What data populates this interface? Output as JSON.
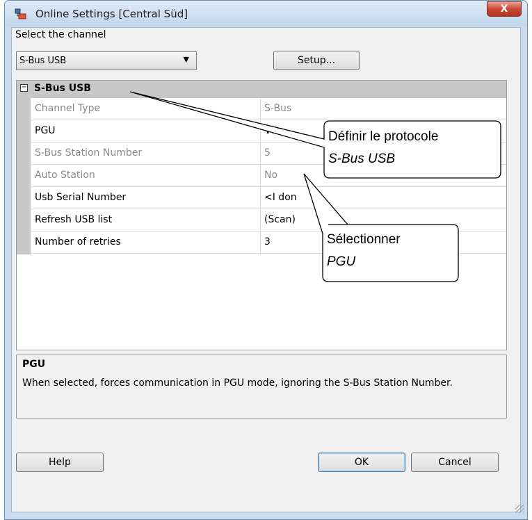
{
  "window": {
    "title": "Online Settings [Central Süd]",
    "close_label": "X"
  },
  "channel": {
    "label": "Select the channel",
    "selected": "S-Bus USB",
    "setup_label": "Setup..."
  },
  "grid": {
    "category": "S-Bus USB",
    "rows": [
      {
        "name": "Channel Type",
        "value": "S-Bus",
        "enabled": false
      },
      {
        "name": "PGU",
        "value": "Yes",
        "enabled": true
      },
      {
        "name": "S-Bus Station Number",
        "value": "5",
        "enabled": false
      },
      {
        "name": "Auto Station",
        "value": "No",
        "enabled": false
      },
      {
        "name": "Usb Serial Number",
        "value": "<I don",
        "enabled": true
      },
      {
        "name": "Refresh USB list",
        "value": "(Scan)",
        "enabled": true
      },
      {
        "name": "Number of retries",
        "value": "3",
        "enabled": true
      }
    ]
  },
  "description": {
    "title": "PGU",
    "text": "When selected, forces communication in PGU mode, ignoring the S-Bus Station Number."
  },
  "buttons": {
    "help": "Help",
    "ok": "OK",
    "cancel": "Cancel"
  },
  "callouts": [
    {
      "line1": "Définir le protocole",
      "line2": "S-Bus USB"
    },
    {
      "line1": "Sélectionner",
      "line2": "PGU"
    }
  ]
}
